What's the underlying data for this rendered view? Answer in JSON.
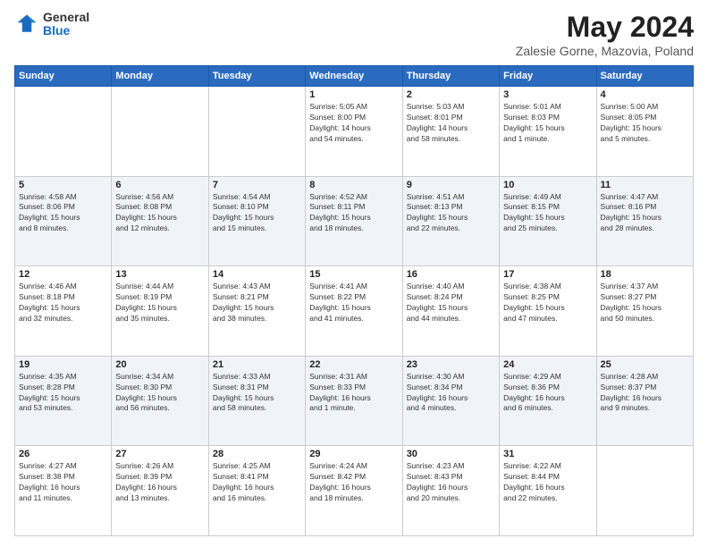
{
  "header": {
    "logo_general": "General",
    "logo_blue": "Blue",
    "title": "May 2024",
    "location": "Zalesie Gorne, Mazovia, Poland"
  },
  "weekdays": [
    "Sunday",
    "Monday",
    "Tuesday",
    "Wednesday",
    "Thursday",
    "Friday",
    "Saturday"
  ],
  "weeks": [
    [
      {
        "day": "",
        "info": ""
      },
      {
        "day": "",
        "info": ""
      },
      {
        "day": "",
        "info": ""
      },
      {
        "day": "1",
        "info": "Sunrise: 5:05 AM\nSunset: 8:00 PM\nDaylight: 14 hours\nand 54 minutes."
      },
      {
        "day": "2",
        "info": "Sunrise: 5:03 AM\nSunset: 8:01 PM\nDaylight: 14 hours\nand 58 minutes."
      },
      {
        "day": "3",
        "info": "Sunrise: 5:01 AM\nSunset: 8:03 PM\nDaylight: 15 hours\nand 1 minute."
      },
      {
        "day": "4",
        "info": "Sunrise: 5:00 AM\nSunset: 8:05 PM\nDaylight: 15 hours\nand 5 minutes."
      }
    ],
    [
      {
        "day": "5",
        "info": "Sunrise: 4:58 AM\nSunset: 8:06 PM\nDaylight: 15 hours\nand 8 minutes."
      },
      {
        "day": "6",
        "info": "Sunrise: 4:56 AM\nSunset: 8:08 PM\nDaylight: 15 hours\nand 12 minutes."
      },
      {
        "day": "7",
        "info": "Sunrise: 4:54 AM\nSunset: 8:10 PM\nDaylight: 15 hours\nand 15 minutes."
      },
      {
        "day": "8",
        "info": "Sunrise: 4:52 AM\nSunset: 8:11 PM\nDaylight: 15 hours\nand 18 minutes."
      },
      {
        "day": "9",
        "info": "Sunrise: 4:51 AM\nSunset: 8:13 PM\nDaylight: 15 hours\nand 22 minutes."
      },
      {
        "day": "10",
        "info": "Sunrise: 4:49 AM\nSunset: 8:15 PM\nDaylight: 15 hours\nand 25 minutes."
      },
      {
        "day": "11",
        "info": "Sunrise: 4:47 AM\nSunset: 8:16 PM\nDaylight: 15 hours\nand 28 minutes."
      }
    ],
    [
      {
        "day": "12",
        "info": "Sunrise: 4:46 AM\nSunset: 8:18 PM\nDaylight: 15 hours\nand 32 minutes."
      },
      {
        "day": "13",
        "info": "Sunrise: 4:44 AM\nSunset: 8:19 PM\nDaylight: 15 hours\nand 35 minutes."
      },
      {
        "day": "14",
        "info": "Sunrise: 4:43 AM\nSunset: 8:21 PM\nDaylight: 15 hours\nand 38 minutes."
      },
      {
        "day": "15",
        "info": "Sunrise: 4:41 AM\nSunset: 8:22 PM\nDaylight: 15 hours\nand 41 minutes."
      },
      {
        "day": "16",
        "info": "Sunrise: 4:40 AM\nSunset: 8:24 PM\nDaylight: 15 hours\nand 44 minutes."
      },
      {
        "day": "17",
        "info": "Sunrise: 4:38 AM\nSunset: 8:25 PM\nDaylight: 15 hours\nand 47 minutes."
      },
      {
        "day": "18",
        "info": "Sunrise: 4:37 AM\nSunset: 8:27 PM\nDaylight: 15 hours\nand 50 minutes."
      }
    ],
    [
      {
        "day": "19",
        "info": "Sunrise: 4:35 AM\nSunset: 8:28 PM\nDaylight: 15 hours\nand 53 minutes."
      },
      {
        "day": "20",
        "info": "Sunrise: 4:34 AM\nSunset: 8:30 PM\nDaylight: 15 hours\nand 56 minutes."
      },
      {
        "day": "21",
        "info": "Sunrise: 4:33 AM\nSunset: 8:31 PM\nDaylight: 15 hours\nand 58 minutes."
      },
      {
        "day": "22",
        "info": "Sunrise: 4:31 AM\nSunset: 8:33 PM\nDaylight: 16 hours\nand 1 minute."
      },
      {
        "day": "23",
        "info": "Sunrise: 4:30 AM\nSunset: 8:34 PM\nDaylight: 16 hours\nand 4 minutes."
      },
      {
        "day": "24",
        "info": "Sunrise: 4:29 AM\nSunset: 8:36 PM\nDaylight: 16 hours\nand 6 minutes."
      },
      {
        "day": "25",
        "info": "Sunrise: 4:28 AM\nSunset: 8:37 PM\nDaylight: 16 hours\nand 9 minutes."
      }
    ],
    [
      {
        "day": "26",
        "info": "Sunrise: 4:27 AM\nSunset: 8:38 PM\nDaylight: 16 hours\nand 11 minutes."
      },
      {
        "day": "27",
        "info": "Sunrise: 4:26 AM\nSunset: 8:39 PM\nDaylight: 16 hours\nand 13 minutes."
      },
      {
        "day": "28",
        "info": "Sunrise: 4:25 AM\nSunset: 8:41 PM\nDaylight: 16 hours\nand 16 minutes."
      },
      {
        "day": "29",
        "info": "Sunrise: 4:24 AM\nSunset: 8:42 PM\nDaylight: 16 hours\nand 18 minutes."
      },
      {
        "day": "30",
        "info": "Sunrise: 4:23 AM\nSunset: 8:43 PM\nDaylight: 16 hours\nand 20 minutes."
      },
      {
        "day": "31",
        "info": "Sunrise: 4:22 AM\nSunset: 8:44 PM\nDaylight: 16 hours\nand 22 minutes."
      },
      {
        "day": "",
        "info": ""
      }
    ]
  ]
}
